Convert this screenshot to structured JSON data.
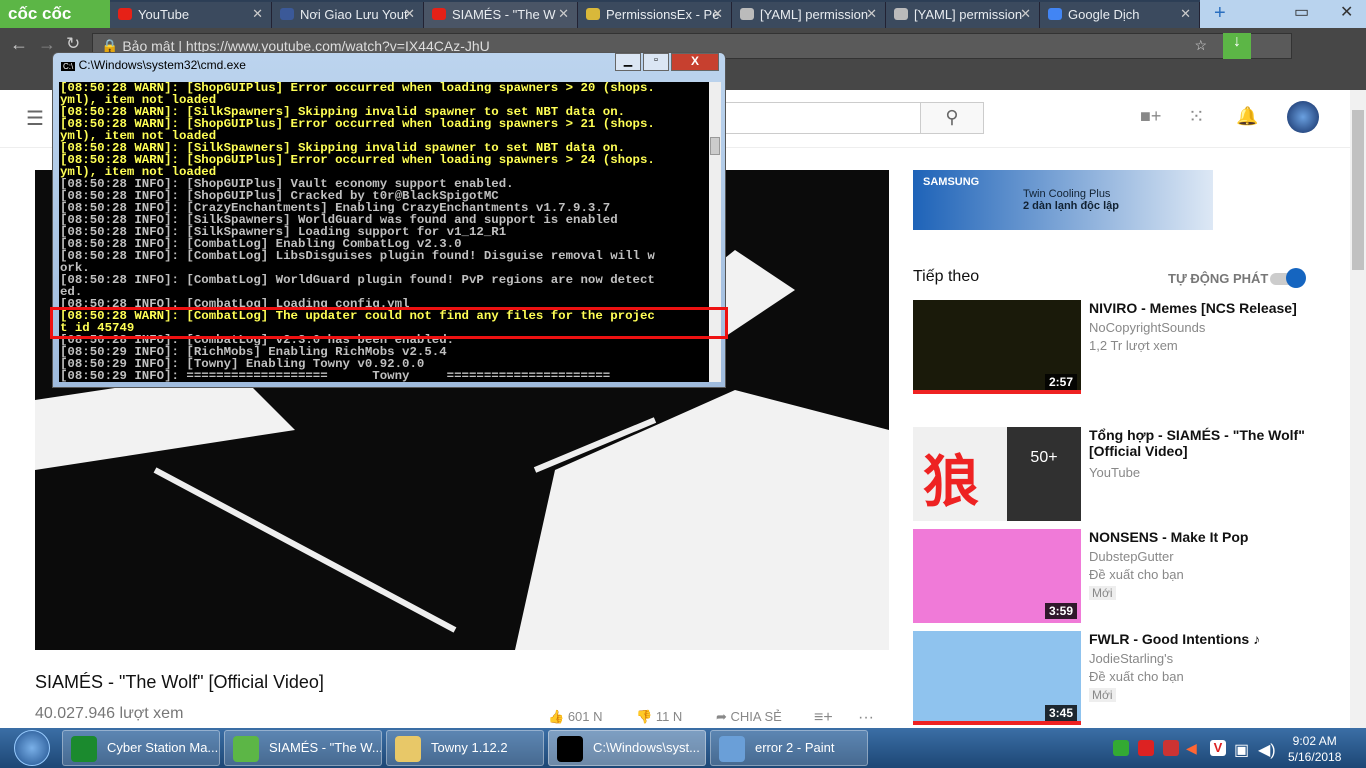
{
  "browser": {
    "brand": "cốc cốc",
    "tabs": [
      {
        "label": "YouTube",
        "color": "#e62117"
      },
      {
        "label": "Nơi Giao Lưu Yout",
        "color": "#3b5998"
      },
      {
        "label": "SIAMÉS - \"The W",
        "color": "#e62117"
      },
      {
        "label": "PermissionsEx - Pe",
        "color": "#d9b83a"
      },
      {
        "label": "[YAML] permission",
        "color": "#bbb"
      },
      {
        "label": "[YAML] permission",
        "color": "#bbb"
      },
      {
        "label": "Google Dịch",
        "color": "#4285f4"
      }
    ],
    "security_label": "Bảo mật",
    "url": "https://www.youtube.com/watch?v=IX44CAz-JhU"
  },
  "cmd": {
    "title": "C:\\Windows\\system32\\cmd.exe",
    "lines": [
      {
        "t": "[08:50:28 WARN]: [ShopGUIPlus] Error occurred when loading spawners > 20 (shops.",
        "w": 1
      },
      {
        "t": "yml), item not loaded",
        "w": 1
      },
      {
        "t": "[08:50:28 WARN]: [SilkSpawners] Skipping invalid spawner to set NBT data on.",
        "w": 1
      },
      {
        "t": "[08:50:28 WARN]: [ShopGUIPlus] Error occurred when loading spawners > 21 (shops.",
        "w": 1
      },
      {
        "t": "yml), item not loaded",
        "w": 1
      },
      {
        "t": "[08:50:28 WARN]: [SilkSpawners] Skipping invalid spawner to set NBT data on.",
        "w": 1
      },
      {
        "t": "[08:50:28 WARN]: [ShopGUIPlus] Error occurred when loading spawners > 24 (shops.",
        "w": 1
      },
      {
        "t": "yml), item not loaded",
        "w": 1
      },
      {
        "t": "[08:50:28 INFO]: [ShopGUIPlus] Vault economy support enabled.",
        "w": 0
      },
      {
        "t": "[08:50:28 INFO]: [ShopGUIPlus] Cracked by t0r@BlackSpigotMC",
        "w": 0
      },
      {
        "t": "[08:50:28 INFO]: [CrazyEnchantments] Enabling CrazyEnchantments v1.7.9.3.7",
        "w": 0
      },
      {
        "t": "[08:50:28 INFO]: [SilkSpawners] WorldGuard was found and support is enabled",
        "w": 0
      },
      {
        "t": "[08:50:28 INFO]: [SilkSpawners] Loading support for v1_12_R1",
        "w": 0
      },
      {
        "t": "[08:50:28 INFO]: [CombatLog] Enabling CombatLog v2.3.0",
        "w": 0
      },
      {
        "t": "[08:50:28 INFO]: [CombatLog] LibsDisguises plugin found! Disguise removal will w",
        "w": 0
      },
      {
        "t": "ork.",
        "w": 0
      },
      {
        "t": "[08:50:28 INFO]: [CombatLog] WorldGuard plugin found! PvP regions are now detect",
        "w": 0
      },
      {
        "t": "ed.",
        "w": 0
      },
      {
        "t": "[08:50:28 INFO]: [CombatLog] Loading config.yml",
        "w": 0
      },
      {
        "t": "[08:50:28 WARN]: [CombatLog] The updater could not find any files for the projec",
        "w": 1
      },
      {
        "t": "t id 45749",
        "w": 1
      },
      {
        "t": "[08:50:28 INFO]: [CombatLog] v2.3.0 has been enabled.",
        "w": 0
      },
      {
        "t": "[08:50:29 INFO]: [RichMobs] Enabling RichMobs v2.5.4",
        "w": 0
      },
      {
        "t": "[08:50:29 INFO]: [Towny] Enabling Towny v0.92.0.0",
        "w": 0
      },
      {
        "t": "[08:50:29 INFO]: ===================      Towny     ======================",
        "w": 0
      }
    ]
  },
  "video": {
    "title": "SIAMÉS - \"The Wolf\" [Official Video]",
    "views": "40.027.946 lượt xem",
    "likes": "601 N",
    "dislikes": "11 N",
    "share": "CHIA SẺ"
  },
  "ad": {
    "brand": "SAMSUNG",
    "line1": "Twin Cooling Plus",
    "line2": "2 dàn lạnh độc lập"
  },
  "sidebar": {
    "next_label": "Tiếp theo",
    "autoplay_label": "TỰ ĐỘNG PHÁT",
    "autoplay_on": true,
    "videos": [
      {
        "title": "NIVIRO - Memes [NCS Release]",
        "channel": "NoCopyrightSounds",
        "meta": "1,2 Tr lượt xem",
        "duration": "2:57",
        "thumb": "#1a1a0a"
      },
      {
        "title": "Tổng hợp - SIAMÉS - \"The Wolf\" [Official Video]",
        "channel": "YouTube",
        "meta": "",
        "overlay": "50+",
        "thumb": "#f0f0f0"
      },
      {
        "title": "NONSENS - Make It Pop",
        "channel": "DubstepGutter",
        "meta": "Đề xuất cho bạn",
        "badge": "Mới",
        "duration": "3:59",
        "thumb": "#f07ad8"
      },
      {
        "title": "FWLR - Good Intentions ♪",
        "channel": "JodieStarling's",
        "meta": "Đề xuất cho bạn",
        "badge": "Mới",
        "duration": "3:45",
        "thumb": "#8fc3ee"
      }
    ]
  },
  "taskbar": {
    "items": [
      {
        "label": "Cyber Station Ma...",
        "color": "#1b8a2e"
      },
      {
        "label": "SIAMÉS - \"The W...",
        "color": "#5cb646"
      },
      {
        "label": "Towny 1.12.2",
        "color": "#e8c868"
      },
      {
        "label": "C:\\Windows\\syst...",
        "color": "#000"
      },
      {
        "label": "error 2 - Paint",
        "color": "#6a9fd8"
      }
    ],
    "time": "9:02 AM",
    "date": "5/16/2018"
  }
}
